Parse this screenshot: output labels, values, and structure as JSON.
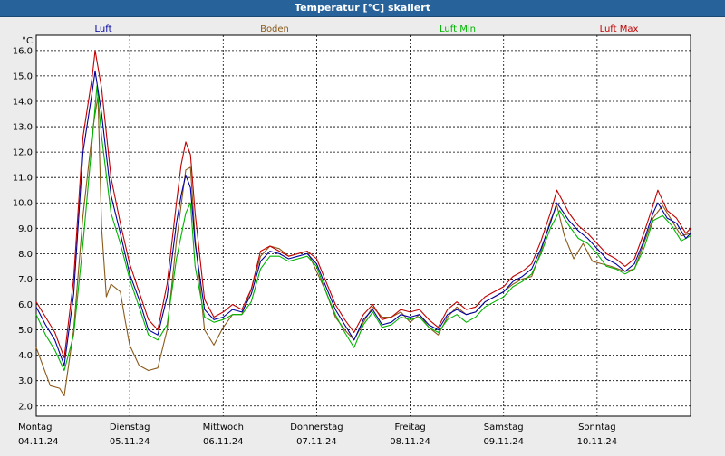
{
  "window": {
    "title": "Temperatur [°C] skaliert"
  },
  "colors": {
    "background": "#ececec",
    "plot_background": "#ffffff",
    "title_bar": "#27639a",
    "grid": "#000000"
  },
  "chart_data": {
    "type": "line",
    "title": "Temperatur [°C] skaliert",
    "ylabel": "°C",
    "xlabel": "",
    "ylim": [
      1.6,
      16.6
    ],
    "yticks": [
      "2.0",
      "3.0",
      "4.0",
      "5.0",
      "6.0",
      "7.0",
      "8.0",
      "9.0",
      "10.0",
      "11.0",
      "12.0",
      "13.0",
      "14.0",
      "15.0",
      "16.0"
    ],
    "xlim": [
      0,
      7
    ],
    "days": [
      {
        "label": "Montag",
        "date": "04.11.24"
      },
      {
        "label": "Dienstag",
        "date": "05.11.24"
      },
      {
        "label": "Mittwoch",
        "date": "06.11.24"
      },
      {
        "label": "Donnerstag",
        "date": "07.11.24"
      },
      {
        "label": "Freitag",
        "date": "08.11.24"
      },
      {
        "label": "Samstag",
        "date": "09.11.24"
      },
      {
        "label": "Sonntag",
        "date": "10.11.24"
      }
    ],
    "grid": true,
    "legend_position": "top",
    "series": [
      {
        "name": "Luft",
        "color": "#0000a0",
        "points": [
          [
            0,
            5.9
          ],
          [
            0.1,
            5.2
          ],
          [
            0.2,
            4.6
          ],
          [
            0.3,
            3.6
          ],
          [
            0.4,
            6.4
          ],
          [
            0.5,
            12.0
          ],
          [
            0.6,
            14.4
          ],
          [
            0.63,
            15.2
          ],
          [
            0.7,
            13.5
          ],
          [
            0.8,
            10.3
          ],
          [
            0.9,
            8.8
          ],
          [
            1.0,
            7.2
          ],
          [
            1.1,
            6.2
          ],
          [
            1.2,
            5.0
          ],
          [
            1.3,
            4.8
          ],
          [
            1.4,
            6.3
          ],
          [
            1.5,
            9.2
          ],
          [
            1.55,
            10.3
          ],
          [
            1.6,
            11.1
          ],
          [
            1.65,
            10.6
          ],
          [
            1.7,
            8.4
          ],
          [
            1.8,
            5.8
          ],
          [
            1.9,
            5.4
          ],
          [
            2.0,
            5.5
          ],
          [
            2.1,
            5.8
          ],
          [
            2.2,
            5.7
          ],
          [
            2.3,
            6.4
          ],
          [
            2.4,
            7.7
          ],
          [
            2.5,
            8.1
          ],
          [
            2.6,
            8.0
          ],
          [
            2.7,
            7.8
          ],
          [
            2.8,
            7.9
          ],
          [
            2.9,
            8.0
          ],
          [
            3.0,
            7.6
          ],
          [
            3.1,
            6.7
          ],
          [
            3.2,
            5.8
          ],
          [
            3.3,
            5.2
          ],
          [
            3.4,
            4.6
          ],
          [
            3.5,
            5.4
          ],
          [
            3.6,
            5.8
          ],
          [
            3.7,
            5.2
          ],
          [
            3.8,
            5.3
          ],
          [
            3.9,
            5.6
          ],
          [
            4.0,
            5.5
          ],
          [
            4.1,
            5.6
          ],
          [
            4.2,
            5.2
          ],
          [
            4.3,
            5.0
          ],
          [
            4.4,
            5.6
          ],
          [
            4.5,
            5.8
          ],
          [
            4.6,
            5.6
          ],
          [
            4.7,
            5.7
          ],
          [
            4.8,
            6.1
          ],
          [
            4.9,
            6.3
          ],
          [
            5.0,
            6.5
          ],
          [
            5.1,
            6.9
          ],
          [
            5.2,
            7.1
          ],
          [
            5.3,
            7.4
          ],
          [
            5.4,
            8.2
          ],
          [
            5.5,
            9.2
          ],
          [
            5.57,
            10.0
          ],
          [
            5.7,
            9.3
          ],
          [
            5.8,
            8.9
          ],
          [
            5.9,
            8.6
          ],
          [
            6.0,
            8.2
          ],
          [
            6.1,
            7.8
          ],
          [
            6.2,
            7.6
          ],
          [
            6.3,
            7.3
          ],
          [
            6.4,
            7.6
          ],
          [
            6.5,
            8.5
          ],
          [
            6.6,
            9.6
          ],
          [
            6.65,
            10.0
          ],
          [
            6.75,
            9.4
          ],
          [
            6.85,
            9.2
          ],
          [
            6.95,
            8.6
          ],
          [
            7.0,
            8.8
          ]
        ]
      },
      {
        "name": "Boden",
        "color": "#8b5a1a",
        "points": [
          [
            0,
            4.3
          ],
          [
            0.1,
            3.3
          ],
          [
            0.15,
            2.8
          ],
          [
            0.25,
            2.7
          ],
          [
            0.3,
            2.4
          ],
          [
            0.4,
            5.0
          ],
          [
            0.5,
            9.5
          ],
          [
            0.6,
            12.8
          ],
          [
            0.66,
            14.2
          ],
          [
            0.7,
            9.0
          ],
          [
            0.75,
            6.3
          ],
          [
            0.8,
            6.8
          ],
          [
            0.9,
            6.5
          ],
          [
            0.95,
            5.4
          ],
          [
            1.0,
            4.4
          ],
          [
            1.1,
            3.6
          ],
          [
            1.2,
            3.4
          ],
          [
            1.3,
            3.5
          ],
          [
            1.4,
            5.0
          ],
          [
            1.5,
            8.5
          ],
          [
            1.6,
            11.3
          ],
          [
            1.65,
            11.4
          ],
          [
            1.7,
            8.6
          ],
          [
            1.8,
            5.0
          ],
          [
            1.9,
            4.4
          ],
          [
            2.0,
            5.1
          ],
          [
            2.1,
            5.6
          ],
          [
            2.2,
            5.6
          ],
          [
            2.3,
            6.6
          ],
          [
            2.4,
            7.9
          ],
          [
            2.5,
            8.3
          ],
          [
            2.6,
            8.2
          ],
          [
            2.7,
            7.9
          ],
          [
            2.8,
            8.0
          ],
          [
            2.9,
            8.1
          ],
          [
            3.0,
            7.3
          ],
          [
            3.1,
            6.5
          ],
          [
            3.2,
            5.5
          ],
          [
            3.3,
            5.0
          ],
          [
            3.4,
            4.6
          ],
          [
            3.5,
            5.3
          ],
          [
            3.6,
            5.9
          ],
          [
            3.7,
            5.5
          ],
          [
            3.8,
            5.5
          ],
          [
            3.9,
            5.7
          ],
          [
            4.0,
            5.3
          ],
          [
            4.1,
            5.6
          ],
          [
            4.2,
            5.1
          ],
          [
            4.3,
            4.8
          ],
          [
            4.4,
            5.5
          ],
          [
            4.5,
            5.9
          ],
          [
            4.6,
            5.6
          ],
          [
            4.7,
            5.7
          ],
          [
            4.8,
            6.1
          ],
          [
            4.9,
            6.3
          ],
          [
            5.0,
            6.5
          ],
          [
            5.1,
            6.8
          ],
          [
            5.2,
            7.0
          ],
          [
            5.3,
            7.1
          ],
          [
            5.4,
            8.1
          ],
          [
            5.5,
            9.3
          ],
          [
            5.57,
            9.9
          ],
          [
            5.65,
            8.7
          ],
          [
            5.75,
            7.8
          ],
          [
            5.85,
            8.4
          ],
          [
            5.95,
            7.7
          ],
          [
            6.05,
            7.6
          ],
          [
            6.15,
            7.5
          ],
          [
            6.3,
            7.3
          ],
          [
            6.4,
            7.4
          ],
          [
            6.5,
            8.4
          ],
          [
            6.6,
            9.4
          ],
          [
            6.7,
            9.9
          ],
          [
            6.8,
            9.3
          ],
          [
            6.9,
            8.7
          ],
          [
            7.0,
            8.8
          ]
        ]
      },
      {
        "name": "Luft Min",
        "color": "#00b400",
        "points": [
          [
            0,
            5.6
          ],
          [
            0.1,
            4.8
          ],
          [
            0.2,
            4.2
          ],
          [
            0.3,
            3.4
          ],
          [
            0.4,
            4.8
          ],
          [
            0.5,
            8.4
          ],
          [
            0.6,
            12.5
          ],
          [
            0.65,
            14.6
          ],
          [
            0.7,
            12.6
          ],
          [
            0.8,
            9.6
          ],
          [
            0.9,
            8.4
          ],
          [
            1.0,
            7.0
          ],
          [
            1.1,
            5.9
          ],
          [
            1.2,
            4.8
          ],
          [
            1.3,
            4.6
          ],
          [
            1.4,
            5.2
          ],
          [
            1.5,
            7.8
          ],
          [
            1.6,
            9.6
          ],
          [
            1.65,
            10.0
          ],
          [
            1.7,
            7.5
          ],
          [
            1.8,
            5.5
          ],
          [
            1.9,
            5.3
          ],
          [
            2.0,
            5.4
          ],
          [
            2.1,
            5.6
          ],
          [
            2.2,
            5.6
          ],
          [
            2.3,
            6.1
          ],
          [
            2.4,
            7.4
          ],
          [
            2.5,
            7.9
          ],
          [
            2.6,
            7.9
          ],
          [
            2.7,
            7.7
          ],
          [
            2.8,
            7.8
          ],
          [
            2.9,
            7.9
          ],
          [
            3.0,
            7.5
          ],
          [
            3.1,
            6.5
          ],
          [
            3.2,
            5.6
          ],
          [
            3.3,
            4.9
          ],
          [
            3.4,
            4.3
          ],
          [
            3.5,
            5.2
          ],
          [
            3.6,
            5.7
          ],
          [
            3.7,
            5.1
          ],
          [
            3.8,
            5.2
          ],
          [
            3.9,
            5.5
          ],
          [
            4.0,
            5.4
          ],
          [
            4.1,
            5.5
          ],
          [
            4.2,
            5.1
          ],
          [
            4.3,
            4.9
          ],
          [
            4.4,
            5.4
          ],
          [
            4.5,
            5.6
          ],
          [
            4.6,
            5.3
          ],
          [
            4.7,
            5.5
          ],
          [
            4.8,
            5.9
          ],
          [
            4.9,
            6.1
          ],
          [
            5.0,
            6.3
          ],
          [
            5.1,
            6.7
          ],
          [
            5.2,
            6.9
          ],
          [
            5.3,
            7.2
          ],
          [
            5.4,
            8.0
          ],
          [
            5.5,
            9.0
          ],
          [
            5.6,
            9.7
          ],
          [
            5.7,
            9.1
          ],
          [
            5.8,
            8.6
          ],
          [
            5.9,
            8.4
          ],
          [
            6.0,
            8.0
          ],
          [
            6.1,
            7.5
          ],
          [
            6.2,
            7.4
          ],
          [
            6.3,
            7.2
          ],
          [
            6.4,
            7.4
          ],
          [
            6.5,
            8.2
          ],
          [
            6.6,
            9.3
          ],
          [
            6.7,
            9.5
          ],
          [
            6.8,
            9.1
          ],
          [
            6.9,
            8.5
          ],
          [
            7.0,
            8.7
          ]
        ]
      },
      {
        "name": "Luft Max",
        "color": "#c00000",
        "points": [
          [
            0,
            6.1
          ],
          [
            0.1,
            5.5
          ],
          [
            0.2,
            4.9
          ],
          [
            0.3,
            3.9
          ],
          [
            0.4,
            7.0
          ],
          [
            0.5,
            12.6
          ],
          [
            0.6,
            15.0
          ],
          [
            0.63,
            16.0
          ],
          [
            0.7,
            14.5
          ],
          [
            0.8,
            11.0
          ],
          [
            0.9,
            9.2
          ],
          [
            1.0,
            7.6
          ],
          [
            1.1,
            6.5
          ],
          [
            1.2,
            5.4
          ],
          [
            1.3,
            5.0
          ],
          [
            1.4,
            6.8
          ],
          [
            1.5,
            10.0
          ],
          [
            1.55,
            11.5
          ],
          [
            1.6,
            12.4
          ],
          [
            1.65,
            11.9
          ],
          [
            1.7,
            9.6
          ],
          [
            1.8,
            6.2
          ],
          [
            1.9,
            5.5
          ],
          [
            2.0,
            5.7
          ],
          [
            2.1,
            6.0
          ],
          [
            2.2,
            5.8
          ],
          [
            2.3,
            6.6
          ],
          [
            2.4,
            8.1
          ],
          [
            2.5,
            8.3
          ],
          [
            2.6,
            8.1
          ],
          [
            2.7,
            7.9
          ],
          [
            2.8,
            8.0
          ],
          [
            2.9,
            8.1
          ],
          [
            3.0,
            7.8
          ],
          [
            3.1,
            6.9
          ],
          [
            3.2,
            6.0
          ],
          [
            3.3,
            5.4
          ],
          [
            3.4,
            4.9
          ],
          [
            3.5,
            5.6
          ],
          [
            3.6,
            6.0
          ],
          [
            3.7,
            5.4
          ],
          [
            3.8,
            5.5
          ],
          [
            3.9,
            5.8
          ],
          [
            4.0,
            5.7
          ],
          [
            4.1,
            5.8
          ],
          [
            4.2,
            5.4
          ],
          [
            4.3,
            5.1
          ],
          [
            4.4,
            5.8
          ],
          [
            4.5,
            6.1
          ],
          [
            4.6,
            5.8
          ],
          [
            4.7,
            5.9
          ],
          [
            4.8,
            6.3
          ],
          [
            4.9,
            6.5
          ],
          [
            5.0,
            6.7
          ],
          [
            5.1,
            7.1
          ],
          [
            5.2,
            7.3
          ],
          [
            5.3,
            7.6
          ],
          [
            5.4,
            8.5
          ],
          [
            5.5,
            9.6
          ],
          [
            5.57,
            10.5
          ],
          [
            5.7,
            9.6
          ],
          [
            5.8,
            9.1
          ],
          [
            5.9,
            8.8
          ],
          [
            6.0,
            8.4
          ],
          [
            6.1,
            8.0
          ],
          [
            6.2,
            7.8
          ],
          [
            6.3,
            7.5
          ],
          [
            6.4,
            7.8
          ],
          [
            6.5,
            8.8
          ],
          [
            6.6,
            9.9
          ],
          [
            6.65,
            10.5
          ],
          [
            6.75,
            9.7
          ],
          [
            6.85,
            9.4
          ],
          [
            6.95,
            8.8
          ],
          [
            7.0,
            9.0
          ]
        ]
      }
    ]
  }
}
